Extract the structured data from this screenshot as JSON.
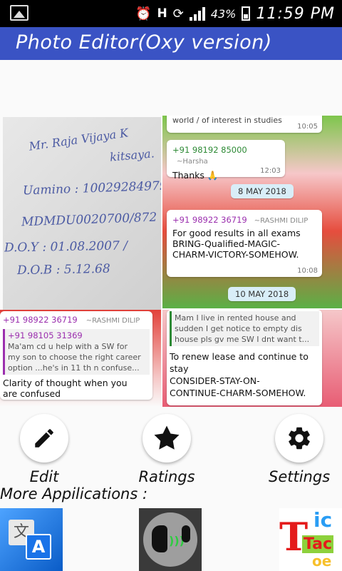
{
  "status_bar": {
    "battery_percent": "43%",
    "time": "11:59 PM",
    "icons": [
      "image-notification-icon",
      "alarm-icon",
      "network-h-icon",
      "data-sync-icon",
      "signal-icon",
      "battery-icon"
    ]
  },
  "app_bar": {
    "title": "Photo Editor(Oxy version)"
  },
  "preview": {
    "paper_lines": [
      "Mr. Raja Vijaya K",
      "kitsaya.",
      "Uamino : 10029284979",
      "MDMDU0020700/872",
      "D.O.Y : 01.08.2007 /",
      "D.O.B : 5.12.68"
    ],
    "chat_top": {
      "top_cut_text": "world / of interest in studies",
      "top_cut_time": "10:05",
      "msg1_sender": "+91 98192 85000",
      "msg1_name": "~Harsha",
      "msg1_text": "Thanks 🙏",
      "msg1_time": "12:03",
      "date1": "8 MAY 2018",
      "msg2_sender": "+91 98922 36719",
      "msg2_name": "~RASHMI DILIP",
      "msg2_text1": "For good results in all exams",
      "msg2_text2": "BRING-Qualified-MAGIC-",
      "msg2_text3": "CHARM-VICTORY-SOMEHOW.",
      "msg2_time": "10:08",
      "date2": "10 MAY 2018"
    },
    "chat_bottom_left": {
      "sender": "+91 98922 36719",
      "name": "~RASHMI DILIP",
      "quote_sender": "+91 98105 31369",
      "quote_text1": "Ma'am cd u help with a SW for",
      "quote_text2": "my son to choose the right career",
      "quote_text3": "option ...he's in 11 th n confuse...",
      "reply1": "Clarity of thought when you",
      "reply2": "are confused"
    },
    "chat_bottom_right": {
      "quote1": "Mam I live in rented house and",
      "quote2": "sudden I get notice to empty dis",
      "quote3": "house pls gv me SW I dnt want t...",
      "reply1": "To renew lease and continue to",
      "reply2": "stay",
      "reply3": "CONSIDER-STAY-ON-",
      "reply4": "CONTINUE-CHARM-SOMEHOW."
    }
  },
  "actions": {
    "edit": "Edit",
    "ratings": "Ratings",
    "settings": "Settings"
  },
  "more_apps": {
    "heading": "More Appilications :",
    "apps": [
      "translate-app-icon",
      "voice-app-icon",
      "tic-tac-toe-app-icon"
    ],
    "tic_tac_toe_letters": [
      "T",
      "ic",
      "Tac",
      "oe"
    ]
  },
  "colors": {
    "app_bar": "#3a53c4",
    "status_bar": "#000000"
  }
}
